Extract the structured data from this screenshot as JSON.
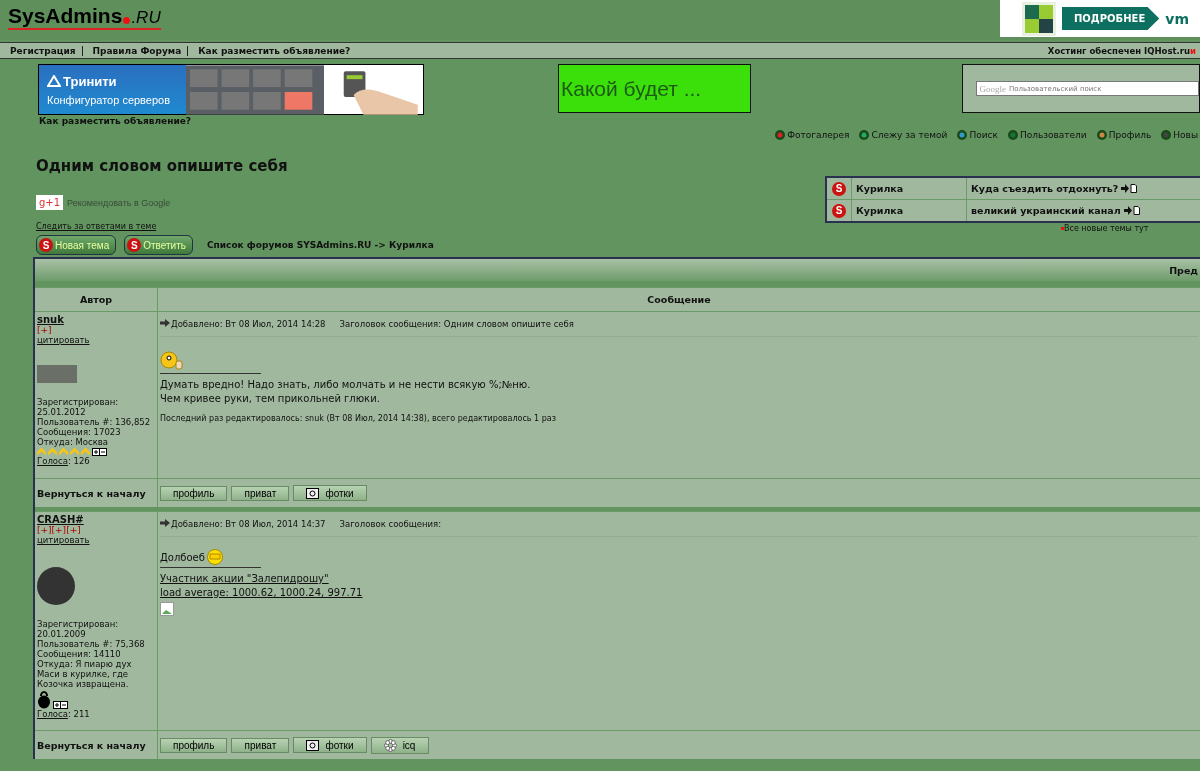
{
  "header": {
    "logo": "SysAdmins",
    "logo_suffix": ".RU",
    "ad_button": "ПОДРОБНЕЕ",
    "ad_brand": "vm"
  },
  "nav": {
    "links": [
      "Регистрация",
      "Правила Форума",
      "Как разместить объявление?"
    ],
    "hosting": "Хостинг обеспечен IQHost.ru",
    "hosting_more": "и"
  },
  "banners": {
    "trinity_title": "Тринити",
    "trinity_subtitle": "Конфигуратор серверов",
    "promo": "Какой будет ...",
    "search": {
      "logo": "Google",
      "placeholder": "Пользовательский поиск"
    }
  },
  "ad_link": "Как разместить объявление?",
  "menu": [
    {
      "label": "Фотогалерея",
      "kind": "star"
    },
    {
      "label": "Слежу за темой",
      "kind": "eye"
    },
    {
      "label": "Поиск",
      "kind": "search"
    },
    {
      "label": "Пользователи",
      "kind": "users"
    },
    {
      "label": "Профиль",
      "kind": "profile"
    },
    {
      "label": "Новы",
      "kind": "mail"
    }
  ],
  "topic": {
    "title": "Одним словом опишите себя",
    "plusone_badge": "g+1",
    "plusone_label": "Рекомендовать в Google",
    "follow_link": "Следить за ответами в теме"
  },
  "new_topics": {
    "rows": [
      {
        "icon": "S",
        "forum": "Курилка",
        "topic": "Куда съездить отдохнуть?"
      },
      {
        "icon": "S",
        "forum": "Курилка",
        "topic": "великий украинский канал"
      }
    ],
    "all_link": "Все новые темы тут"
  },
  "actions": [
    {
      "icon": "S",
      "label": "Новая тема"
    },
    {
      "icon": "S",
      "label": "Ответить"
    }
  ],
  "breadcrumb": "Список форумов SYSAdmins.RU -> Курилка",
  "table": {
    "header_right": "Пред",
    "columns": [
      "Автор",
      "Сообщение"
    ]
  },
  "posts": [
    {
      "author": "snuk",
      "reputation": "[+]",
      "quote": "цитировать",
      "avatar": {
        "kind": "wide"
      },
      "details": [
        "Зарегистрирован: 25.01.2012",
        "Пользователь #: 136,852",
        "Сообщения: 17023",
        "Откуда: Москва"
      ],
      "rank": {
        "kind": "stars",
        "stars": 5
      },
      "votes_label": "Голоса",
      "votes": ": 126",
      "posted": "Добавлено: Вт 08 Июл, 2014 14:28",
      "subject": "Заголовок сообщения: Одним словом опишите себя",
      "smiley": {
        "kind": "wave"
      },
      "signature": [
        {
          "text": "Думать вредно! Надо знать, либо молчать и не нести всякую %;№ню.",
          "link": false
        },
        {
          "text": "Чем кривее руки, тем прикольней глюки.",
          "link": false
        }
      ],
      "broken_image": false,
      "edit_note": "Последний раз редактировалось: snuk (Вт 08 Июл, 2014 14:38), всего редактировалось 1 раз",
      "back": "Вернуться к началу",
      "buttons": [
        {
          "label": "профиль",
          "kind": "plain"
        },
        {
          "label": "приват",
          "kind": "plain"
        },
        {
          "label": "фотки",
          "kind": "photo"
        }
      ]
    },
    {
      "author": "CRASH#",
      "reputation": "[+][+][+]",
      "quote": "цитировать",
      "avatar": {
        "kind": "round"
      },
      "details": [
        "Зарегистрирован: 20.01.2009",
        "Пользователь #: 75,368",
        "Сообщения: 14110",
        "Откуда: Я пиарю дух Маси в курилке, где Козочка извращена."
      ],
      "rank": {
        "kind": "kettlebell"
      },
      "votes_label": "Голоса",
      "votes": ": 211",
      "posted": "Добавлено: Вт 08 Июл, 2014 14:37",
      "subject": "Заголовок сообщения:",
      "smiley": {
        "kind": "facepalm"
      },
      "text": "Долбоеб",
      "signature": [
        {
          "text": "Участник акции \"Залепидрошу\"",
          "link": true
        },
        {
          "text": "load average: 1000.62, 1000.24, 997.71",
          "link": true
        }
      ],
      "broken_image": true,
      "back": "Вернуться к началу",
      "buttons": [
        {
          "label": "профиль",
          "kind": "plain"
        },
        {
          "label": "приват",
          "kind": "plain"
        },
        {
          "label": "фотки",
          "kind": "photo"
        },
        {
          "label": "icq",
          "kind": "icq"
        }
      ]
    }
  ]
}
